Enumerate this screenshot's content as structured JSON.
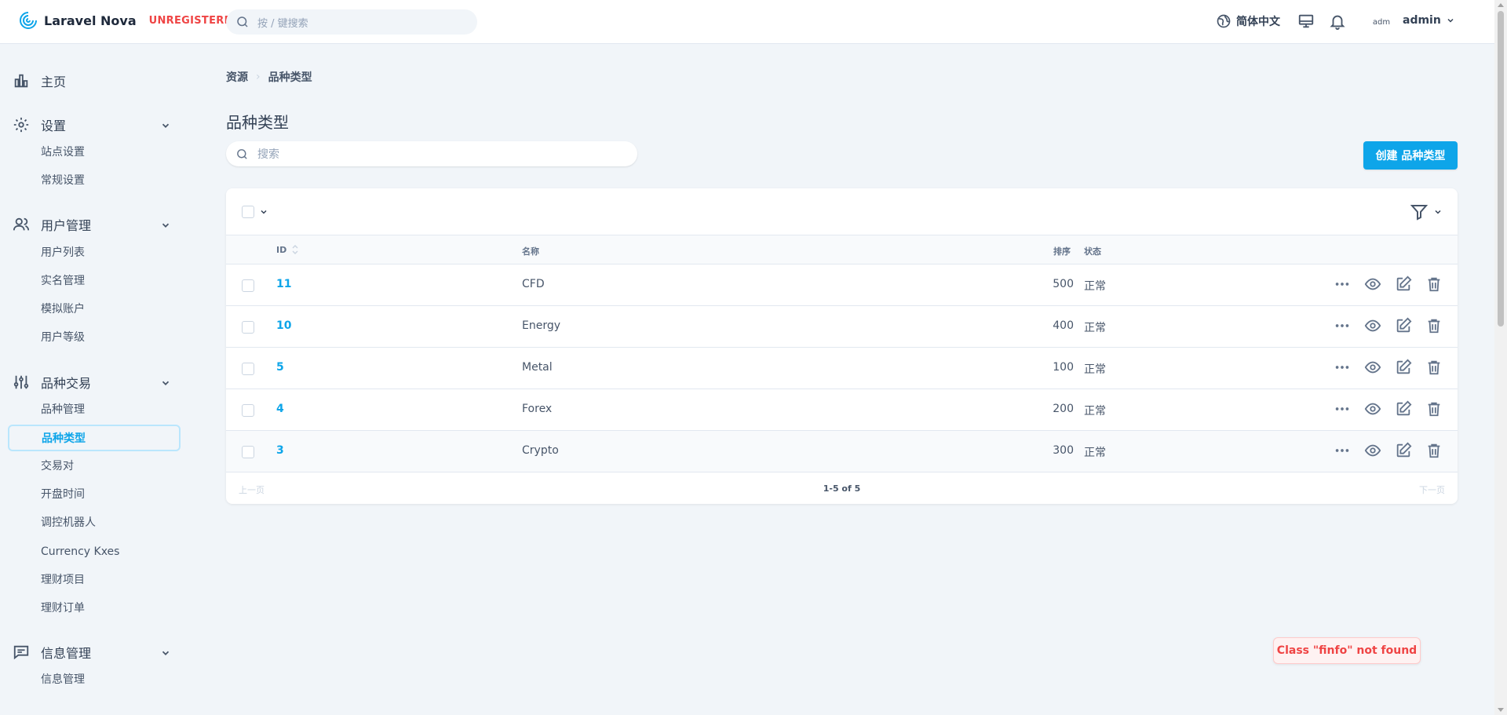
{
  "header": {
    "brand_name": "Laravel Nova",
    "brand_badge": "UNREGISTERED",
    "search_placeholder": "按 / 键搜索",
    "language": "简体中文",
    "avatar_alt": "adm",
    "username": "admin"
  },
  "sidebar": {
    "groups": [
      {
        "label": "主页",
        "icon": "chart-bar-icon"
      },
      {
        "label": "设置",
        "icon": "gear-icon",
        "items": [
          "站点设置",
          "常规设置"
        ]
      },
      {
        "label": "用户管理",
        "icon": "users-icon",
        "items": [
          "用户列表",
          "实名管理",
          "模拟账户",
          "用户等级"
        ]
      },
      {
        "label": "品种交易",
        "icon": "sliders-icon",
        "items": [
          "品种管理",
          "品种类型",
          "交易对",
          "开盘时间",
          "调控机器人",
          "Currency Kxes",
          "理财项目",
          "理财订单"
        ]
      },
      {
        "label": "信息管理",
        "icon": "chat-icon",
        "items": [
          "信息管理"
        ]
      }
    ],
    "active_item": "品种类型"
  },
  "main": {
    "breadcrumb": [
      "资源",
      "品种类型"
    ],
    "title": "品种类型",
    "search_placeholder": "搜索",
    "create_button": "创建 品种类型",
    "table": {
      "columns": [
        "ID",
        "名称",
        "排序",
        "状态"
      ],
      "rows": [
        {
          "id": "11",
          "name": "CFD",
          "sort": "500",
          "status": "正常"
        },
        {
          "id": "10",
          "name": "Energy",
          "sort": "400",
          "status": "正常"
        },
        {
          "id": "5",
          "name": "Metal",
          "sort": "100",
          "status": "正常"
        },
        {
          "id": "4",
          "name": "Forex",
          "sort": "200",
          "status": "正常"
        },
        {
          "id": "3",
          "name": "Crypto",
          "sort": "300",
          "status": "正常"
        }
      ]
    },
    "pagination": {
      "prev": "上一页",
      "info": "1-5 of 5",
      "next": "下一页"
    }
  },
  "toast": "Class \"finfo\" not found",
  "colors": {
    "accent": "#0ea5e9",
    "error": "#ef4444"
  }
}
